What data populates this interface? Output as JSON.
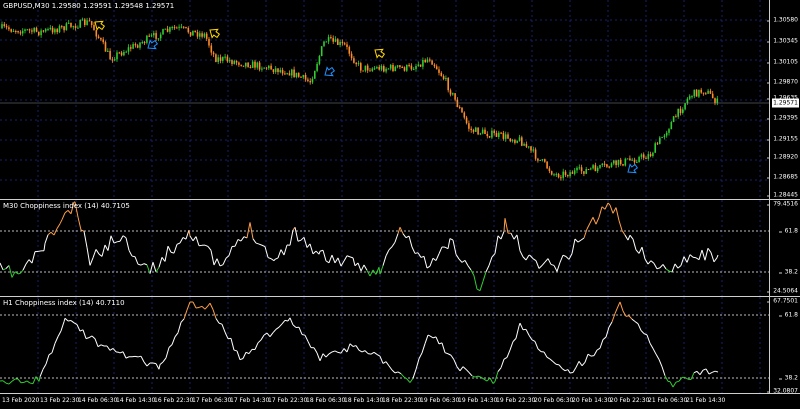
{
  "main": {
    "title": "GBPUSD,M30  1.29580 1.29591 1.29548 1.29571",
    "price_ticks": [
      "1.30580",
      "1.30345",
      "1.30105",
      "1.29870",
      "1.29635",
      "1.29395",
      "1.29155",
      "1.28920",
      "1.28685",
      "1.28445"
    ],
    "current_price": "1.29571",
    "colors": {
      "bull": "#32cd32",
      "bear": "#ff8c2a",
      "arrow_up": "#1e90ff",
      "arrow_down": "#ffd700",
      "grid": "#1e2a6e"
    }
  },
  "ind1": {
    "title": "M30 Choppiness index (14) 40.7105",
    "ticks": [
      "79.4516",
      "61.8",
      "38.2",
      "24.5064"
    ],
    "levels": [
      61.8,
      38.2
    ],
    "range": [
      24.5064,
      79.4516
    ]
  },
  "ind2": {
    "title": "H1 Choppiness index (14) 40.7110",
    "ticks": [
      "67.7501",
      "61.8",
      "38.2",
      "32.0807"
    ],
    "levels": [
      61.8,
      38.2
    ],
    "range": [
      32.0807,
      67.7501
    ]
  },
  "time_labels": [
    "13 Feb 2020",
    "13 Feb 22:30",
    "14 Feb 06:30",
    "14 Feb 14:30",
    "16 Feb 22:30",
    "17 Feb 06:30",
    "17 Feb 14:30",
    "17 Feb 22:30",
    "18 Feb 06:30",
    "18 Feb 14:30",
    "18 Feb 22:30",
    "19 Feb 06:30",
    "19 Feb 14:30",
    "19 Feb 22:30",
    "20 Feb 06:30",
    "20 Feb 14:30",
    "20 Feb 22:30",
    "21 Feb 06:30",
    "21 Feb 14:30"
  ]
}
